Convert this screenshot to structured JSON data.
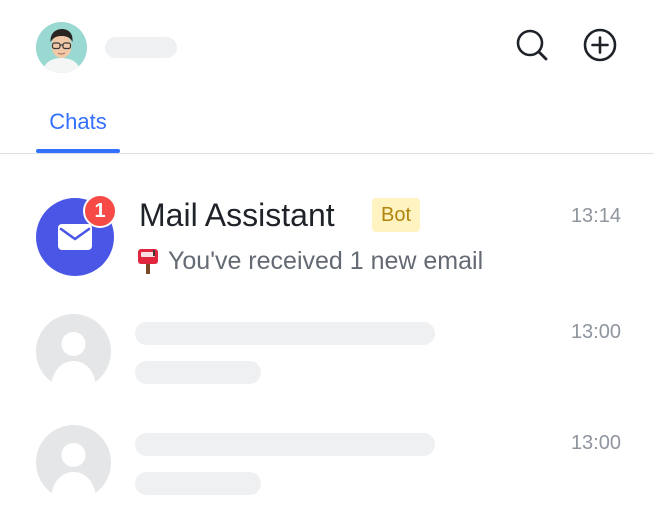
{
  "header": {
    "search_icon": "search-icon",
    "add_icon": "plus-circle-icon"
  },
  "tabs": [
    {
      "label": "Chats",
      "active": true
    }
  ],
  "chats": [
    {
      "title": "Mail Assistant",
      "tag": "Bot",
      "unread": "1",
      "time": "13:14",
      "preview_icon": "mailbox-icon",
      "preview": "You've received 1 new email",
      "avatar_icon": "envelope-icon"
    },
    {
      "time": "13:00",
      "placeholder": true
    },
    {
      "time": "13:00",
      "placeholder": true
    }
  ],
  "colors": {
    "accent": "#3370ff",
    "mail_avatar": "#4a57e6",
    "badge": "#f54a45",
    "bot_tag_bg": "#fff3c2",
    "bot_tag_text": "#b0850d"
  }
}
